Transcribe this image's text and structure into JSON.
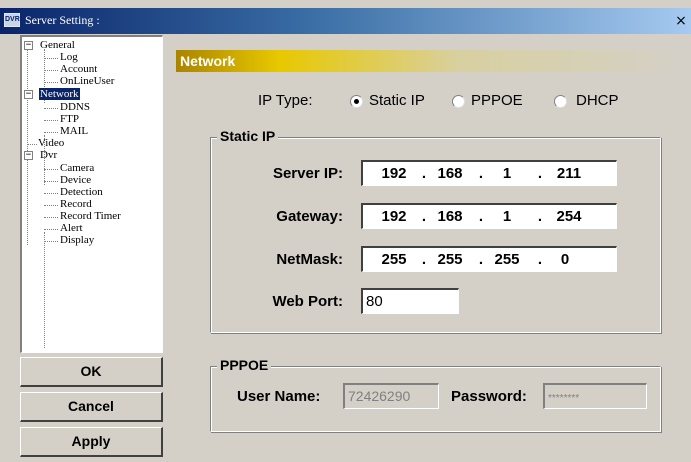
{
  "window": {
    "title": "Server Setting :",
    "close_glyph": "×",
    "title_icon": "app-icon"
  },
  "tree": {
    "items": [
      {
        "label": "General",
        "level": 0,
        "toggle": "−"
      },
      {
        "label": "Log",
        "level": 1
      },
      {
        "label": "Account",
        "level": 1
      },
      {
        "label": "OnLineUser",
        "level": 1
      },
      {
        "label": "Network",
        "level": 0,
        "toggle": "−",
        "selected": true
      },
      {
        "label": "DDNS",
        "level": 1
      },
      {
        "label": "FTP",
        "level": 1
      },
      {
        "label": "MAIL",
        "level": 1
      },
      {
        "label": "Video",
        "level": 0
      },
      {
        "label": "Dvr",
        "level": 0,
        "toggle": "−"
      },
      {
        "label": "Camera",
        "level": 1
      },
      {
        "label": "Device",
        "level": 1
      },
      {
        "label": "Detection",
        "level": 1
      },
      {
        "label": "Record",
        "level": 1
      },
      {
        "label": "Record Timer",
        "level": 1
      },
      {
        "label": "Alert",
        "level": 1
      },
      {
        "label": "Display",
        "level": 1
      }
    ]
  },
  "buttons": {
    "ok": "OK",
    "cancel": "Cancel",
    "apply": "Apply"
  },
  "network": {
    "header": "Network",
    "ip_type_label": "IP Type:",
    "ip_type_options": [
      "Static IP",
      "PPPOE",
      "DHCP"
    ],
    "ip_type_selected": "Static IP",
    "static_ip": {
      "legend": "Static IP",
      "server_ip_label": "Server IP:",
      "server_ip": [
        "192",
        "168",
        "1",
        "211"
      ],
      "gateway_label": "Gateway:",
      "gateway": [
        "192",
        "168",
        "1",
        "254"
      ],
      "netmask_label": "NetMask:",
      "netmask": [
        "255",
        "255",
        "255",
        "0"
      ],
      "web_port_label": "Web Port:",
      "web_port": "80"
    },
    "pppoe": {
      "legend": "PPPOE",
      "user_name_label": "User Name:",
      "user_name": "72426290",
      "password_label": "Password:",
      "password_mask": "********"
    }
  },
  "colors": {
    "title_bar": "#0a246a",
    "header_bar": "#e8c800",
    "face": "#d4d0c8",
    "selection": "#0a246a"
  }
}
